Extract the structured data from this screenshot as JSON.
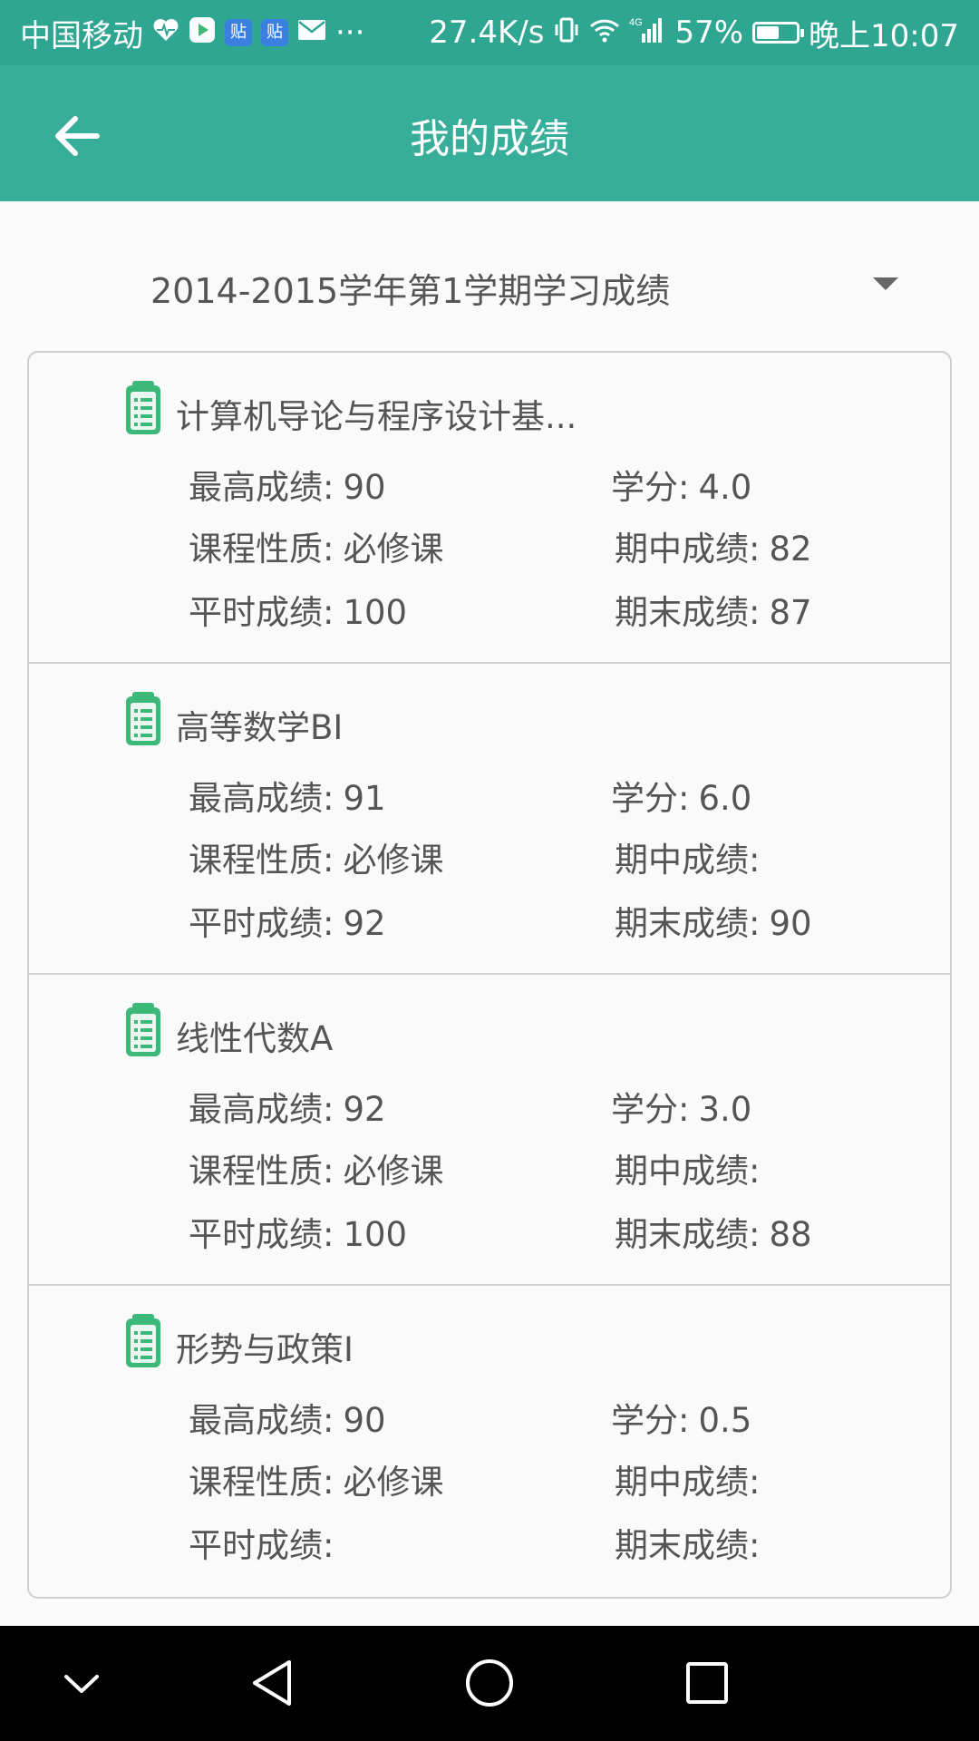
{
  "status_bar": {
    "carrier": "中国移动",
    "ellipsis": "···",
    "net_speed": "27.4K/s",
    "signal_label": "4G",
    "battery_percent": "57%",
    "battery_level": 0.57,
    "time": "晚上10:07",
    "badge_text": "贴",
    "icons": [
      "heart-pulse-icon",
      "play-icon",
      "tieba-icon",
      "tieba-icon",
      "mail-icon",
      "vibrate-icon",
      "wifi-icon",
      "signal-icon",
      "battery-icon"
    ]
  },
  "app_bar": {
    "title": "我的成绩",
    "back_icon": "arrow-left-icon"
  },
  "term_selector": {
    "value": "2014-2015学年第1学期学习成绩",
    "icon": "dropdown-arrow-icon"
  },
  "labels": {
    "max_score": "最高成绩:",
    "credit": "学分:",
    "course_type": "课程性质:",
    "midterm": "期中成绩:",
    "regular": "平时成绩:",
    "final": "期末成绩:"
  },
  "courses": [
    {
      "name": "计算机导论与程序设计基...",
      "max_score": "90",
      "credit": "4.0",
      "course_type": "必修课",
      "midterm": "82",
      "regular": "100",
      "final": "87"
    },
    {
      "name": "高等数学BI",
      "max_score": "91",
      "credit": "6.0",
      "course_type": "必修课",
      "midterm": "",
      "regular": "92",
      "final": "90"
    },
    {
      "name": "线性代数A",
      "max_score": "92",
      "credit": "3.0",
      "course_type": "必修课",
      "midterm": "",
      "regular": "100",
      "final": "88"
    },
    {
      "name": "形势与政策I",
      "max_score": "90",
      "credit": "0.5",
      "course_type": "必修课",
      "midterm": "",
      "regular": "",
      "final": ""
    }
  ],
  "nav_bar": {
    "buttons": [
      "collapse-chevron-icon",
      "back-triangle-icon",
      "home-circle-icon",
      "recents-square-icon"
    ]
  },
  "colors": {
    "primary": "#37ae9a",
    "status_bar": "#2fa691",
    "icon_green": "#3cb878"
  }
}
